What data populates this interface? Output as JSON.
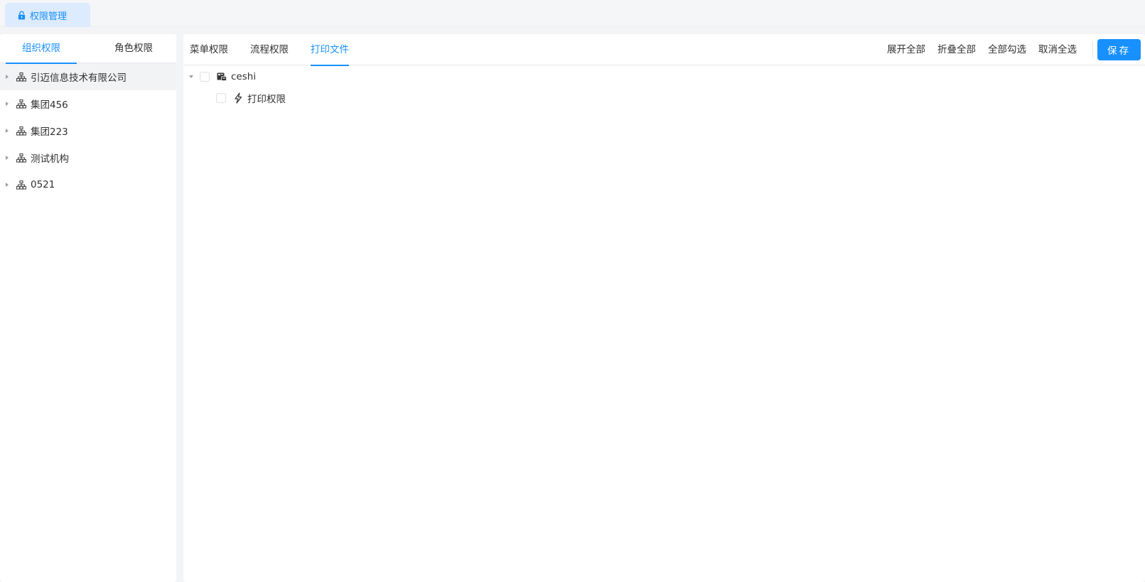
{
  "top_tab": {
    "label": "权限管理",
    "icon": "lock-icon"
  },
  "left_panel": {
    "tabs": [
      {
        "label": "组织权限",
        "active": true
      },
      {
        "label": "角色权限",
        "active": false
      }
    ],
    "org_items": [
      {
        "label": "引迈信息技术有限公司",
        "selected": true
      },
      {
        "label": "集团456"
      },
      {
        "label": "集团223"
      },
      {
        "label": "测试机构"
      },
      {
        "label": "0521"
      }
    ]
  },
  "right_panel": {
    "tabs": [
      {
        "label": "菜单权限"
      },
      {
        "label": "流程权限"
      },
      {
        "label": "打印文件",
        "active": true
      }
    ],
    "actions": {
      "expand_all": "展开全部",
      "collapse_all": "折叠全部",
      "check_all": "全部勾选",
      "uncheck_all": "取消全选",
      "save": "保存"
    },
    "tree": {
      "root": {
        "label": "ceshi",
        "icon": "print-template-icon"
      },
      "child": {
        "label": "打印权限",
        "icon": "lightning-icon"
      }
    }
  },
  "colors": {
    "accent": "#1890ff",
    "tab_bg": "#dcebfd",
    "page_bg": "#f3f4f6"
  }
}
